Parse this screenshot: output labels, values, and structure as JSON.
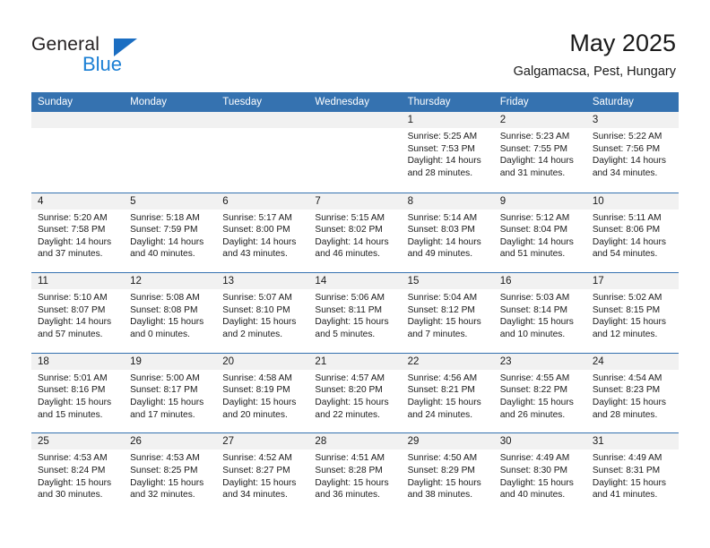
{
  "brand": {
    "name_part1": "General",
    "name_part2": "Blue",
    "accent_color": "#1b7fd4"
  },
  "header": {
    "title": "May 2025",
    "location": "Galgamacsa, Pest, Hungary"
  },
  "calendar": {
    "header_color": "#3572b0",
    "weekdays": [
      "Sunday",
      "Monday",
      "Tuesday",
      "Wednesday",
      "Thursday",
      "Friday",
      "Saturday"
    ],
    "weeks": [
      [
        {
          "day": "",
          "empty": true
        },
        {
          "day": "",
          "empty": true
        },
        {
          "day": "",
          "empty": true
        },
        {
          "day": "",
          "empty": true
        },
        {
          "day": "1",
          "sunrise": "Sunrise: 5:25 AM",
          "sunset": "Sunset: 7:53 PM",
          "daylight": "Daylight: 14 hours and 28 minutes."
        },
        {
          "day": "2",
          "sunrise": "Sunrise: 5:23 AM",
          "sunset": "Sunset: 7:55 PM",
          "daylight": "Daylight: 14 hours and 31 minutes."
        },
        {
          "day": "3",
          "sunrise": "Sunrise: 5:22 AM",
          "sunset": "Sunset: 7:56 PM",
          "daylight": "Daylight: 14 hours and 34 minutes."
        }
      ],
      [
        {
          "day": "4",
          "sunrise": "Sunrise: 5:20 AM",
          "sunset": "Sunset: 7:58 PM",
          "daylight": "Daylight: 14 hours and 37 minutes."
        },
        {
          "day": "5",
          "sunrise": "Sunrise: 5:18 AM",
          "sunset": "Sunset: 7:59 PM",
          "daylight": "Daylight: 14 hours and 40 minutes."
        },
        {
          "day": "6",
          "sunrise": "Sunrise: 5:17 AM",
          "sunset": "Sunset: 8:00 PM",
          "daylight": "Daylight: 14 hours and 43 minutes."
        },
        {
          "day": "7",
          "sunrise": "Sunrise: 5:15 AM",
          "sunset": "Sunset: 8:02 PM",
          "daylight": "Daylight: 14 hours and 46 minutes."
        },
        {
          "day": "8",
          "sunrise": "Sunrise: 5:14 AM",
          "sunset": "Sunset: 8:03 PM",
          "daylight": "Daylight: 14 hours and 49 minutes."
        },
        {
          "day": "9",
          "sunrise": "Sunrise: 5:12 AM",
          "sunset": "Sunset: 8:04 PM",
          "daylight": "Daylight: 14 hours and 51 minutes."
        },
        {
          "day": "10",
          "sunrise": "Sunrise: 5:11 AM",
          "sunset": "Sunset: 8:06 PM",
          "daylight": "Daylight: 14 hours and 54 minutes."
        }
      ],
      [
        {
          "day": "11",
          "sunrise": "Sunrise: 5:10 AM",
          "sunset": "Sunset: 8:07 PM",
          "daylight": "Daylight: 14 hours and 57 minutes."
        },
        {
          "day": "12",
          "sunrise": "Sunrise: 5:08 AM",
          "sunset": "Sunset: 8:08 PM",
          "daylight": "Daylight: 15 hours and 0 minutes."
        },
        {
          "day": "13",
          "sunrise": "Sunrise: 5:07 AM",
          "sunset": "Sunset: 8:10 PM",
          "daylight": "Daylight: 15 hours and 2 minutes."
        },
        {
          "day": "14",
          "sunrise": "Sunrise: 5:06 AM",
          "sunset": "Sunset: 8:11 PM",
          "daylight": "Daylight: 15 hours and 5 minutes."
        },
        {
          "day": "15",
          "sunrise": "Sunrise: 5:04 AM",
          "sunset": "Sunset: 8:12 PM",
          "daylight": "Daylight: 15 hours and 7 minutes."
        },
        {
          "day": "16",
          "sunrise": "Sunrise: 5:03 AM",
          "sunset": "Sunset: 8:14 PM",
          "daylight": "Daylight: 15 hours and 10 minutes."
        },
        {
          "day": "17",
          "sunrise": "Sunrise: 5:02 AM",
          "sunset": "Sunset: 8:15 PM",
          "daylight": "Daylight: 15 hours and 12 minutes."
        }
      ],
      [
        {
          "day": "18",
          "sunrise": "Sunrise: 5:01 AM",
          "sunset": "Sunset: 8:16 PM",
          "daylight": "Daylight: 15 hours and 15 minutes."
        },
        {
          "day": "19",
          "sunrise": "Sunrise: 5:00 AM",
          "sunset": "Sunset: 8:17 PM",
          "daylight": "Daylight: 15 hours and 17 minutes."
        },
        {
          "day": "20",
          "sunrise": "Sunrise: 4:58 AM",
          "sunset": "Sunset: 8:19 PM",
          "daylight": "Daylight: 15 hours and 20 minutes."
        },
        {
          "day": "21",
          "sunrise": "Sunrise: 4:57 AM",
          "sunset": "Sunset: 8:20 PM",
          "daylight": "Daylight: 15 hours and 22 minutes."
        },
        {
          "day": "22",
          "sunrise": "Sunrise: 4:56 AM",
          "sunset": "Sunset: 8:21 PM",
          "daylight": "Daylight: 15 hours and 24 minutes."
        },
        {
          "day": "23",
          "sunrise": "Sunrise: 4:55 AM",
          "sunset": "Sunset: 8:22 PM",
          "daylight": "Daylight: 15 hours and 26 minutes."
        },
        {
          "day": "24",
          "sunrise": "Sunrise: 4:54 AM",
          "sunset": "Sunset: 8:23 PM",
          "daylight": "Daylight: 15 hours and 28 minutes."
        }
      ],
      [
        {
          "day": "25",
          "sunrise": "Sunrise: 4:53 AM",
          "sunset": "Sunset: 8:24 PM",
          "daylight": "Daylight: 15 hours and 30 minutes."
        },
        {
          "day": "26",
          "sunrise": "Sunrise: 4:53 AM",
          "sunset": "Sunset: 8:25 PM",
          "daylight": "Daylight: 15 hours and 32 minutes."
        },
        {
          "day": "27",
          "sunrise": "Sunrise: 4:52 AM",
          "sunset": "Sunset: 8:27 PM",
          "daylight": "Daylight: 15 hours and 34 minutes."
        },
        {
          "day": "28",
          "sunrise": "Sunrise: 4:51 AM",
          "sunset": "Sunset: 8:28 PM",
          "daylight": "Daylight: 15 hours and 36 minutes."
        },
        {
          "day": "29",
          "sunrise": "Sunrise: 4:50 AM",
          "sunset": "Sunset: 8:29 PM",
          "daylight": "Daylight: 15 hours and 38 minutes."
        },
        {
          "day": "30",
          "sunrise": "Sunrise: 4:49 AM",
          "sunset": "Sunset: 8:30 PM",
          "daylight": "Daylight: 15 hours and 40 minutes."
        },
        {
          "day": "31",
          "sunrise": "Sunrise: 4:49 AM",
          "sunset": "Sunset: 8:31 PM",
          "daylight": "Daylight: 15 hours and 41 minutes."
        }
      ]
    ]
  }
}
